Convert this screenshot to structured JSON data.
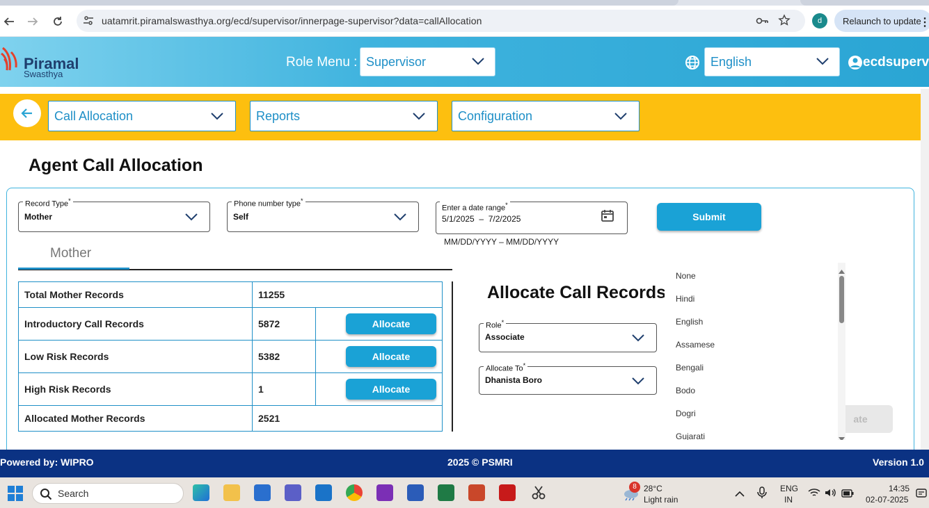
{
  "browser": {
    "url": "uatamrit.piramalswasthya.org/ecd/supervisor/innerpage-supervisor?data=callAllocation",
    "profile_initial": "d",
    "relaunch_label": "Relaunch to update"
  },
  "header": {
    "logo_name": "Piramal",
    "logo_sub": "Swasthya",
    "role_menu_label": "Role Menu :",
    "role_value": "Supervisor",
    "language_value": "English",
    "user_name": "ecdsupervis"
  },
  "menubar": {
    "items": [
      {
        "label": "Call Allocation"
      },
      {
        "label": "Reports"
      },
      {
        "label": "Configuration"
      }
    ]
  },
  "page": {
    "title": "Agent Call Allocation",
    "record_type_label": "Record Type",
    "record_type_value": "Mother",
    "phone_type_label": "Phone number type",
    "phone_type_value": "Self",
    "date_range_label": "Enter a date range",
    "date_range_value": "5/1/2025  –  7/2/2025",
    "date_hint": "MM/DD/YYYY – MM/DD/YYYY",
    "submit_label": "Submit",
    "tab_label": "Mother",
    "required_mark": "*"
  },
  "records": [
    {
      "label": "Total Mother Records",
      "value": "11255",
      "action": ""
    },
    {
      "label": "Introductory Call Records",
      "value": "5872",
      "action": "Allocate"
    },
    {
      "label": "Low Risk Records",
      "value": "5382",
      "action": "Allocate"
    },
    {
      "label": "High Risk Records",
      "value": "1",
      "action": "Allocate"
    },
    {
      "label": "Allocated Mother Records",
      "value": "2521",
      "action": ""
    }
  ],
  "allocate": {
    "title": "Allocate Call Records",
    "role_label": "Role",
    "role_value": "Associate",
    "allocate_to_label": "Allocate To",
    "allocate_to_value": "Dhanista Boro",
    "ghost_button": "ate"
  },
  "language_options": [
    "None",
    "Hindi",
    "English",
    "Assamese",
    "Bengali",
    "Bodo",
    "Dogri",
    "Gujarati"
  ],
  "footer": {
    "left": "Powered by: WIPRO",
    "center": "2025 © PSMRI",
    "right": "Version 1.0"
  },
  "taskbar": {
    "search_placeholder": "Search",
    "weather_temp": "28°C",
    "weather_desc": "Light rain",
    "weather_badge": "8",
    "lang_line1": "ENG",
    "lang_line2": "IN",
    "time": "14:35",
    "date": "02-07-2025"
  },
  "colors": {
    "accent": "#1e8fc7",
    "menubar": "#fdbf0f",
    "footer": "#0b3283",
    "button": "#1aa2d6"
  }
}
